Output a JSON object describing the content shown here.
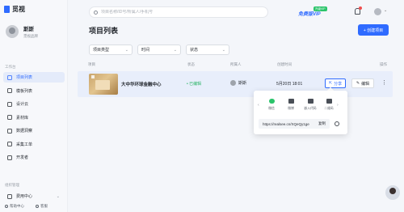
{
  "app": {
    "logo_text": "觅视"
  },
  "user": {
    "name": "斯斯",
    "role": "觅视品牌"
  },
  "sidebar": {
    "section_workspace": "工作台",
    "items": [
      {
        "label": "项目列表",
        "icon": "list-icon",
        "active": true
      },
      {
        "label": "模板列表",
        "icon": "template-icon"
      },
      {
        "label": "设计云",
        "icon": "cloud-icon"
      },
      {
        "label": "素材库",
        "icon": "folder-icon"
      },
      {
        "label": "数据洞察",
        "icon": "chart-icon"
      },
      {
        "label": "采集工单",
        "icon": "ticket-icon"
      },
      {
        "label": "开发者",
        "icon": "code-icon"
      }
    ],
    "section_org": "组织管理",
    "org_items": [
      {
        "label": "费用中心",
        "icon": "wallet-icon"
      }
    ],
    "help": "帮助中心",
    "contact": "客服"
  },
  "topbar": {
    "search_placeholder": "项目名称/ID号/所属人/手机号",
    "vip_text": "免费版VIP",
    "vip_badge": "升级VIP"
  },
  "main": {
    "title": "项目列表",
    "create_button": "+ 创建项目",
    "filters": [
      "项目类型",
      "时间",
      "状态"
    ],
    "columns": [
      "项目",
      "状态",
      "所属人",
      "创建时间",
      "操作"
    ],
    "rows": [
      {
        "name": "大中华环球金融中心",
        "status": "• 已编辑",
        "owner": "斯斯",
        "created": "5月20日 18:01",
        "share_label": "分享",
        "edit_label": "编辑"
      }
    ]
  },
  "share_popover": {
    "options": [
      "微信",
      "微博",
      "嵌入代码",
      "二维码"
    ],
    "link": "https://realsee.cn/XQeQy1ge",
    "copy_label": "复制"
  },
  "colors": {
    "accent": "#2f6bff",
    "success": "#2bb567",
    "row_highlight": "#e8eefb"
  }
}
